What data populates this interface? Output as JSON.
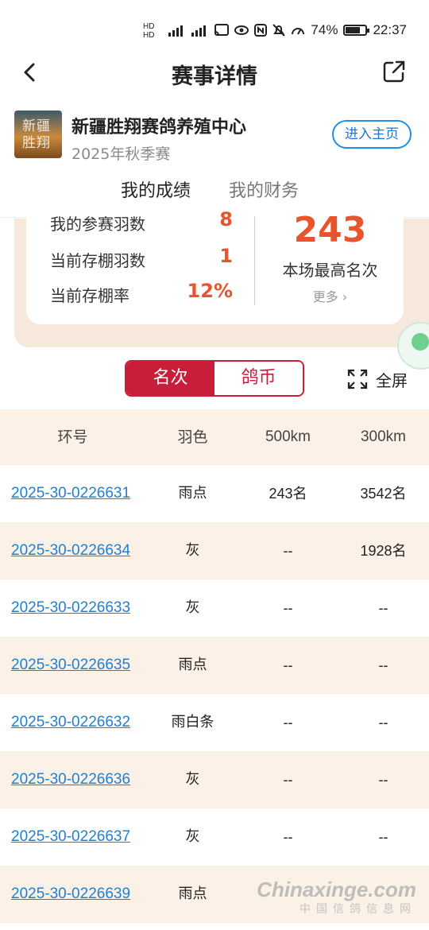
{
  "status_bar": {
    "network_badge": "HD",
    "battery_percent": "74%",
    "time": "22:37",
    "battery_level": 0.74
  },
  "nav": {
    "title": "赛事详情"
  },
  "club": {
    "logo_text": "新疆胜翔",
    "name": "新疆胜翔赛鸽养殖中心",
    "season": "2025年秋季赛",
    "enter_button": "进入主页"
  },
  "tabs": [
    {
      "label": "我的成绩",
      "active": true
    },
    {
      "label": "我的财务",
      "active": false
    }
  ],
  "summary": {
    "stats": [
      {
        "label": "我的参赛羽数",
        "value": "8"
      },
      {
        "label": "当前存棚羽数",
        "value": "1"
      },
      {
        "label": "当前存棚率",
        "value": "12%"
      }
    ],
    "best_rank": "243",
    "best_rank_label": "本场最高名次",
    "more_link": "更多"
  },
  "segment": {
    "options": [
      "名次",
      "鸽币"
    ],
    "active_index": 0
  },
  "fullscreen_label": "全屏",
  "table": {
    "headers": [
      "环号",
      "羽色",
      "500km",
      "300km"
    ],
    "rows": [
      [
        "2025-30-0226631",
        "雨点",
        "243名",
        "3542名"
      ],
      [
        "2025-30-0226634",
        "灰",
        "--",
        "1928名"
      ],
      [
        "2025-30-0226633",
        "灰",
        "--",
        "--"
      ],
      [
        "2025-30-0226635",
        "雨点",
        "--",
        "--"
      ],
      [
        "2025-30-0226632",
        "雨白条",
        "--",
        "--"
      ],
      [
        "2025-30-0226636",
        "灰",
        "--",
        "--"
      ],
      [
        "2025-30-0226637",
        "灰",
        "--",
        "--"
      ],
      [
        "2025-30-0226639",
        "雨点",
        "",
        ""
      ]
    ]
  },
  "watermark": {
    "main": "Chinaxinge.com",
    "sub": "中国信鸽信息网"
  },
  "colors": {
    "accent_red": "#c81e3a",
    "stat_orange": "#e8542c",
    "link_blue": "#1e7fd6",
    "row_alt_bg": "#fcf1e7"
  }
}
